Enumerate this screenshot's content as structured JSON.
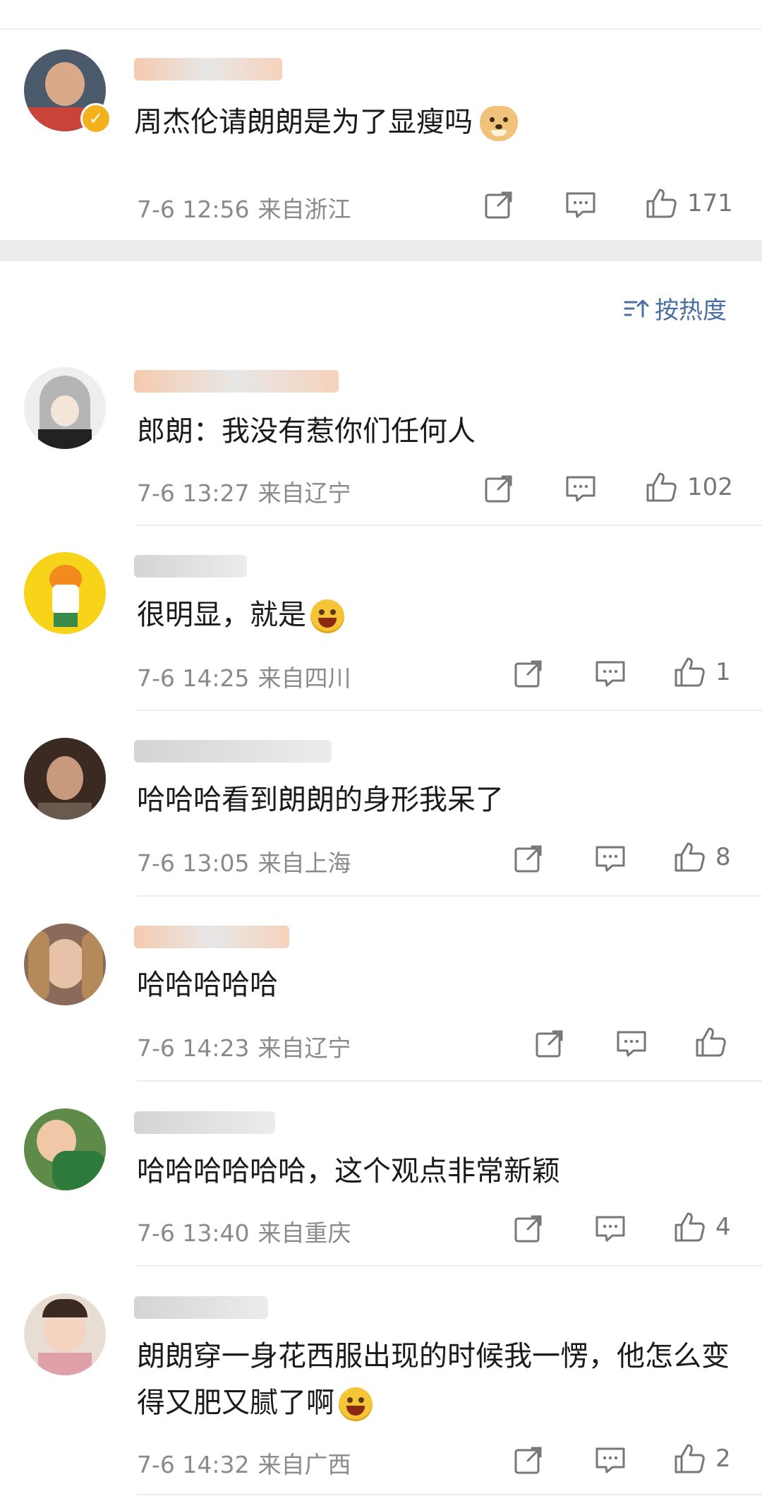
{
  "sort": {
    "label": "按热度"
  },
  "comments": [
    {
      "username": "",
      "text": "周杰伦请朗朗是为了显瘦吗",
      "date": "7-6 12:56",
      "location": "来自浙江",
      "likes": "171",
      "avatar_color": "#4a5a6a",
      "emoji": "doge"
    },
    {
      "username": "",
      "text": "郎朗：我没有惹你们任何人",
      "date": "7-6 13:27",
      "location": "来自辽宁",
      "likes": "102",
      "avatar_color": "#d9d9d9",
      "emoji": ""
    },
    {
      "username": "",
      "text": "很明显，就是",
      "date": "7-6 14:25",
      "location": "来自四川",
      "likes": "1",
      "avatar_color": "#f7d31a",
      "emoji": "laugh"
    },
    {
      "username": "",
      "text": "哈哈哈看到朗朗的身形我呆了",
      "date": "7-6 13:05",
      "location": "来自上海",
      "likes": "8",
      "avatar_color": "#3b2a22",
      "emoji": ""
    },
    {
      "username": "",
      "text": "哈哈哈哈哈",
      "date": "7-6 14:23",
      "location": "来自辽宁",
      "likes": "",
      "avatar_color": "#8a6a58",
      "emoji": ""
    },
    {
      "username": "",
      "text": "哈哈哈哈哈哈，这个观点非常新颖",
      "date": "7-6 13:40",
      "location": "来自重庆",
      "likes": "4",
      "avatar_color": "#5e8a4a",
      "emoji": ""
    },
    {
      "username": "",
      "text": "朗朗穿一身花西服出现的时候我一愣，他怎么变得又肥又腻了啊",
      "date": "7-6 14:32",
      "location": "来自广西",
      "likes": "2",
      "avatar_color": "#c9b7a8",
      "emoji": "laugh"
    }
  ]
}
